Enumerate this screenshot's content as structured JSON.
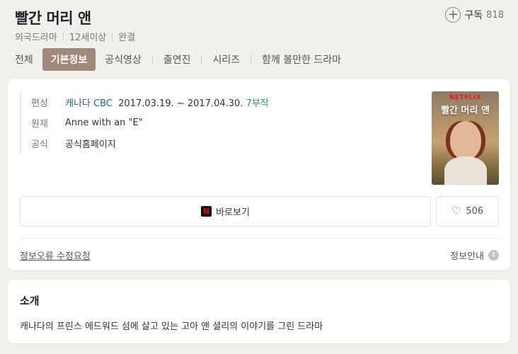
{
  "header": {
    "title": "빨간 머리 앤",
    "subscribe_label": "구독",
    "subscribe_count": "818",
    "meta": [
      "외국드라마",
      "12세이상",
      "완결"
    ]
  },
  "tabs": [
    {
      "label": "전체",
      "active": false
    },
    {
      "label": "기본정보",
      "active": true
    },
    {
      "label": "공식영상",
      "active": false
    },
    {
      "label": "출연진",
      "active": false
    },
    {
      "label": "시리즈",
      "active": false
    },
    {
      "label": "함께 볼만한 드라마",
      "active": false
    }
  ],
  "info": {
    "broadcast_label": "편성",
    "country": "캐나다",
    "network": "CBC",
    "dates": "2017.03.19. ~ 2017.04.30.",
    "episodes": "7부작",
    "original_title_label": "원제",
    "original_title": "Anne with an \"E\"",
    "official_label": "공식",
    "official_link": "공식홈페이지"
  },
  "poster": {
    "brand": "NETFLIX",
    "title": "빨간 머리 앤"
  },
  "actions": {
    "watch_label": "바로보기",
    "like_count": "506"
  },
  "footer": {
    "report_label": "정보오류 수정요청",
    "guide_label": "정보안내"
  },
  "intro": {
    "title": "소개",
    "text": "캐나다의 프린스 에드워드 섬에 살고 있는 고아 앤 셜리의 이야기를 그린 드라마"
  },
  "colors": {
    "active_tab": "#a0887a",
    "link_blue": "#245f96",
    "episodes_green": "#2c9c4e",
    "heart_red": "#e0455a",
    "netflix_red": "#e50914"
  }
}
